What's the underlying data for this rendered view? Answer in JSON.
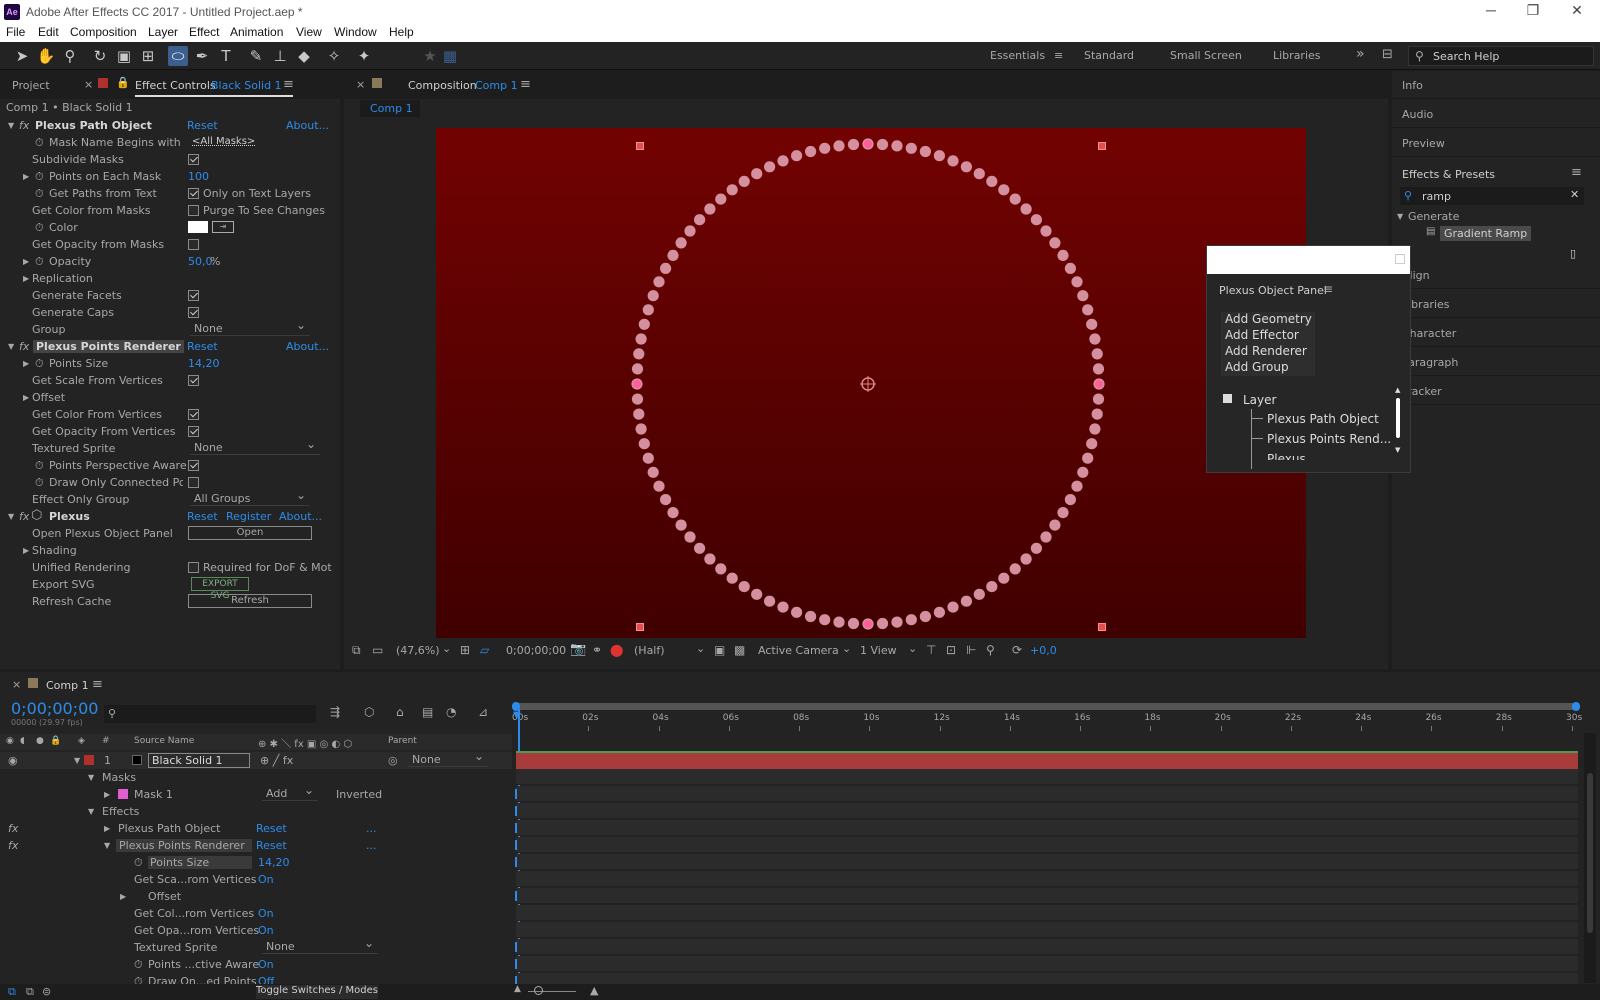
{
  "app": {
    "icon": "Ae",
    "title": "Adobe After Effects CC 2017 - Untitled Project.aep *"
  },
  "window_controls": {
    "minimize": "─",
    "maximize": "❐",
    "close": "✕"
  },
  "menu": [
    "File",
    "Edit",
    "Composition",
    "Layer",
    "Effect",
    "Animation",
    "View",
    "Window",
    "Help"
  ],
  "toolbar": {
    "tools": [
      "selection-tool",
      "hand-tool",
      "zoom-tool",
      "rotate-tool",
      "camera-tool",
      "pan-behind-tool",
      "ellipse-tool",
      "pen-tool",
      "type-tool",
      "brush-tool",
      "clone-stamp-tool",
      "eraser-tool",
      "roto-brush-tool",
      "puppet-pin-tool"
    ],
    "workspaces": [
      "Essentials",
      "Standard",
      "Small Screen",
      "Libraries"
    ],
    "active_workspace": "Essentials",
    "search_placeholder": "Search Help",
    "more": "»"
  },
  "left_panel": {
    "tab_project": "Project",
    "tab_effect_controls": "Effect Controls",
    "layer_name": "Black Solid 1",
    "breadcrumb": "Comp 1 • Black Solid 1",
    "groups": [
      {
        "name": "Plexus Path Object",
        "reset": "Reset",
        "about": "About..."
      },
      {
        "name": "Plexus Points Renderer",
        "reset": "Reset",
        "about": "About..."
      },
      {
        "name": "Plexus",
        "reset": "Reset",
        "register": "Register",
        "about": "About..."
      }
    ],
    "rows": {
      "mask_name": "Mask Name Begins with",
      "mask_name_val": "<All Masks>",
      "subdivide": "Subdivide Masks",
      "points_each": "Points on Each Mask",
      "points_each_val": "100",
      "get_paths": "Get Paths from Text",
      "only_text": "Only on Text Layers",
      "color_masks": "Get Color from Masks",
      "purge": "Purge To See Changes",
      "color": "Color",
      "opacity_masks": "Get Opacity from Masks",
      "opacity": "Opacity",
      "opacity_val": "50,0",
      "opacity_unit": "%",
      "replication": "Replication",
      "facets": "Generate Facets",
      "caps": "Generate Caps",
      "group": "Group",
      "group_val": "None",
      "points_size": "Points Size",
      "points_size_val": "14,20",
      "scale_vertices": "Get Scale From Vertices",
      "offset": "Offset",
      "color_vertices": "Get Color From Vertices",
      "opacity_vertices": "Get Opacity From Vertices",
      "sprite": "Textured Sprite",
      "sprite_val": "None",
      "perspective": "Points Perspective Aware",
      "draw_connected": "Draw Only Connected Point",
      "effect_only": "Effect Only Group",
      "effect_only_val": "All Groups",
      "open_panel": "Open Plexus Object Panel",
      "open_btn": "Open",
      "shading": "Shading",
      "unified": "Unified Rendering",
      "dof": "Required for DoF & Mot",
      "export_svg": "Export SVG",
      "export_btn": "EXPORT SVG",
      "refresh_cache": "Refresh Cache",
      "refresh_btn": "Refresh"
    }
  },
  "comp_panel": {
    "tab_label": "Composition",
    "comp_name": "Comp 1",
    "subtab": "Comp 1",
    "zoom": "(47,6%)",
    "timecode": "0;00;00;00",
    "resolution": "(Half)",
    "camera": "Active Camera",
    "views": "1 View",
    "exposure": "+0,0"
  },
  "right_panel": {
    "items": [
      "Info",
      "Audio",
      "Preview"
    ],
    "effects_presets": "Effects & Presets",
    "search_value": "ramp",
    "category": "Generate",
    "result": "Gradient Ramp",
    "items2": [
      "Align",
      "Libraries",
      "Character",
      "Paragraph",
      "Tracker"
    ]
  },
  "plexus_panel": {
    "title": "Plexus Object Panel",
    "buttons": [
      "Add Geometry",
      "Add Effector",
      "Add Renderer",
      "Add Group"
    ],
    "tree_root": "Layer",
    "tree_items": [
      "Plexus Path Object",
      "Plexus Points Rend...",
      "Plexus"
    ]
  },
  "timeline": {
    "tab": "Comp 1",
    "timecode": "0;00;00;00",
    "fps": "00000 (29.97 fps)",
    "search_placeholder": "",
    "col_source": "Source Name",
    "col_parent": "Parent",
    "col_num": "#",
    "ticks": [
      "00s",
      "02s",
      "04s",
      "06s",
      "08s",
      "10s",
      "12s",
      "14s",
      "16s",
      "18s",
      "20s",
      "22s",
      "24s",
      "26s",
      "28s",
      "30s"
    ],
    "layer": {
      "num": "1",
      "name": "Black Solid 1",
      "parent": "None"
    },
    "masks": "Masks",
    "mask1": "Mask 1",
    "mask_mode": "Add",
    "inverted": "Inverted",
    "effects": "Effects",
    "fx1": "Plexus Path Object",
    "fx2": "Plexus Points Renderer",
    "reset": "Reset",
    "dots": "...",
    "props": [
      {
        "n": "Points Size",
        "v": "14,20"
      },
      {
        "n": "Get Sca...rom Vertices",
        "v": "On"
      },
      {
        "n": "Offset",
        "v": ""
      },
      {
        "n": "Get Col...rom Vertices",
        "v": "On"
      },
      {
        "n": "Get Opa...rom Vertices",
        "v": "On"
      },
      {
        "n": "Textured Sprite",
        "v": "None"
      },
      {
        "n": "Points ...ctive Aware",
        "v": "On"
      },
      {
        "n": "Draw On...ed Points",
        "v": "Off"
      }
    ],
    "toggle": "Toggle Switches / Modes"
  }
}
